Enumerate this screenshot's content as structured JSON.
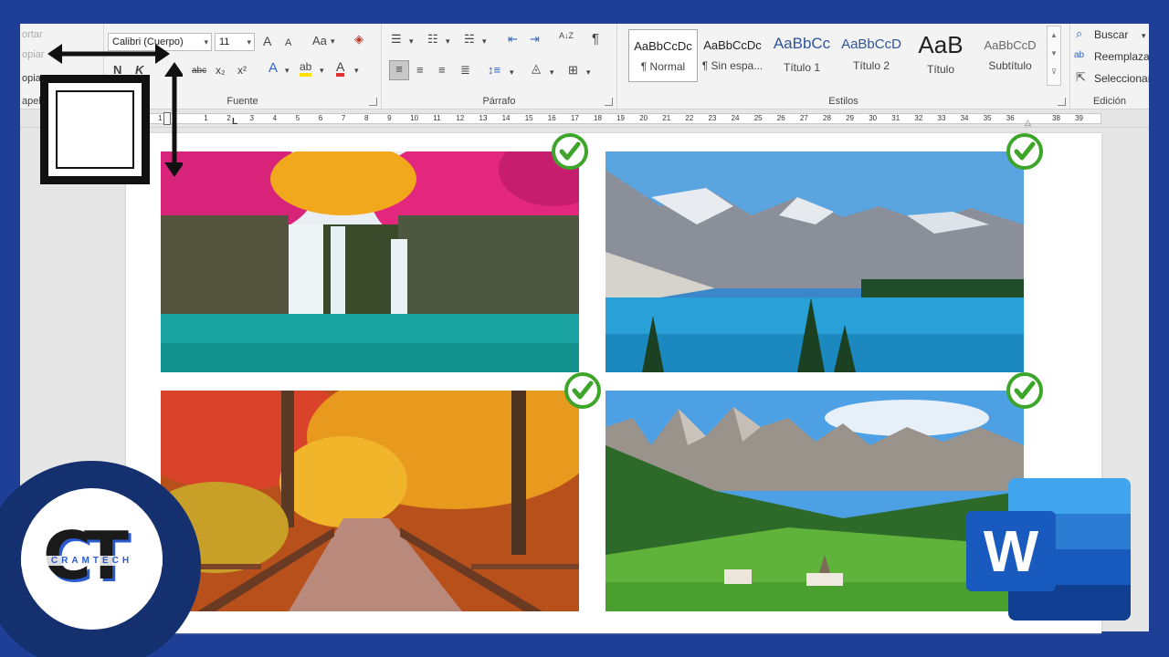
{
  "ribbon": {
    "clipboard": {
      "cut": "ortar",
      "copy": "opiar",
      "paste_format": "opiar",
      "label": "apele"
    },
    "font": {
      "family": "Calibri (Cuerpo)",
      "size": "11",
      "grow": "A",
      "shrink": "A",
      "case": "Aa",
      "bold": "N",
      "italic": "K",
      "strike": "abc",
      "subscript": "x₂",
      "superscript": "x²",
      "effects": "A",
      "highlight": "ab",
      "color": "A",
      "label": "Fuente"
    },
    "paragraph": {
      "sort": "A↓Z",
      "pilcrow": "¶",
      "label": "Párrafo"
    },
    "styles": {
      "items": [
        {
          "sample": "AaBbCcDc",
          "name": "¶ Normal"
        },
        {
          "sample": "AaBbCcDc",
          "name": "¶ Sin espa..."
        },
        {
          "sample": "AaBbCc",
          "name": "Título 1"
        },
        {
          "sample": "AaBbCcD",
          "name": "Título 2"
        },
        {
          "sample": "AaB",
          "name": "Título"
        },
        {
          "sample": "AaBbCcD",
          "name": "Subtítulo"
        }
      ],
      "label": "Estilos"
    },
    "editing": {
      "find": "Buscar",
      "replace": "Reemplaza",
      "select": "Seleccionar",
      "label": "Edición"
    }
  },
  "ruler": {
    "numbers": [
      "2",
      "1",
      "",
      "1",
      "2",
      "3",
      "4",
      "5",
      "6",
      "7",
      "8",
      "9",
      "10",
      "11",
      "12",
      "13",
      "14",
      "15",
      "16",
      "17",
      "18",
      "19",
      "20",
      "21",
      "22",
      "23",
      "24",
      "25",
      "26",
      "27",
      "28",
      "29",
      "30",
      "31",
      "32",
      "33",
      "34",
      "35",
      "36",
      "",
      "38",
      "39"
    ]
  },
  "document": {
    "images": [
      {
        "subject": "waterfall",
        "checked": true
      },
      {
        "subject": "mountain-lake",
        "checked": true
      },
      {
        "subject": "autumn-bridge",
        "checked": true
      },
      {
        "subject": "dolomites-village",
        "checked": true
      }
    ]
  },
  "overlay": {
    "channel_logo_letters": "CT",
    "channel_logo_name": "CRAMTECH",
    "app_logo_letter": "W"
  },
  "colors": {
    "background": "#1f3f96",
    "check_green": "#3da52a",
    "word_blue": "#185abd"
  }
}
